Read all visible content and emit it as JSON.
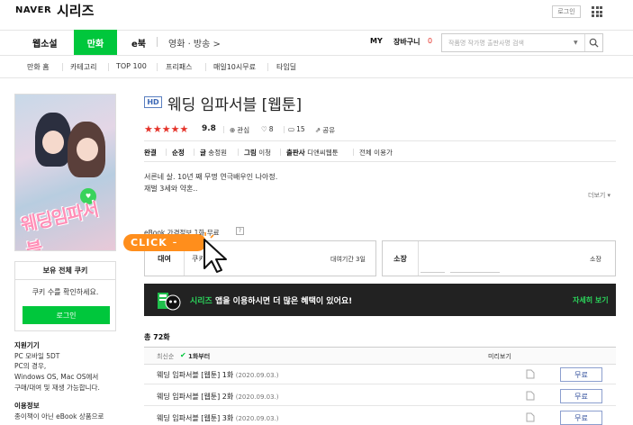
{
  "header": {
    "brand_naver": "NAVER",
    "brand_series": "시리즈",
    "login": "로그인"
  },
  "nav": {
    "items": [
      "웹소설",
      "만화",
      "e북"
    ],
    "active": "만화",
    "movie": "영화 · 방송 >",
    "my": "MY",
    "cart": "장바구니",
    "cart_count": "0",
    "search_placeholder": "작품명  작가명  출판사명 검색",
    "search_caret": "▼"
  },
  "subnav": [
    "만화 홈",
    "카테고리",
    "TOP 100",
    "프리패스",
    "매일10시무료",
    "타임딜"
  ],
  "product": {
    "badge": "HD",
    "title": "웨딩 임파서블 [웹툰]",
    "stars": "★★★★★",
    "rating": "9.8",
    "meta": {
      "watch": "관심",
      "like_count": "8",
      "comment_count": "15",
      "share": "공유"
    },
    "info": {
      "status": "완결",
      "genre": "순정",
      "writer_label": "글",
      "writer": "송정원",
      "art_label": "그림",
      "artist": "이청",
      "publisher_label": "출판사",
      "publisher": "디앤씨웹툰",
      "age": "전체 이용가"
    },
    "desc_line1": "서른네 살. 10년 째 무명 연극배우인 나아정.",
    "desc_line2": "재벌 3세와 약혼..",
    "more": "더보기 ▾",
    "ebook_head": "eBook 가격정보 1화 무료",
    "ebook_help": "?",
    "rent_label": "대여",
    "rent_cookie": "쿠키",
    "rent_period": "대여기간 3일",
    "own_label": "소장",
    "own_text": "소장"
  },
  "click_badge": "CLICK",
  "cover": {
    "title_art": "웨딩임파서블"
  },
  "cookie_box": {
    "head": "보유 전체 쿠키",
    "message": "쿠키 수를 확인하세요.",
    "login": "로그인"
  },
  "left_info": {
    "device_head": "지원기기",
    "device_lines": [
      "PC 모바일 5DT",
      "PC의 경우,",
      "Windows OS, Mac OS에서",
      "구매/대여 및 재생 가능합니다."
    ],
    "usage_head": "이용정보",
    "usage_lines": [
      "종이책이 아닌 eBook 상품으로"
    ]
  },
  "banner": {
    "text_green": "시리즈",
    "text_white": " 앱을 이용하시면 더 많은 혜택이 있어요!",
    "more": "자세히 보기"
  },
  "episodes": {
    "count": "총 72화",
    "sort_latest": "최신순",
    "sort_first": "1화부터",
    "preview_header": "미리보기",
    "rows": [
      {
        "title": "웨딩 임파서블 [웹툰] 1화",
        "date": "(2020.09.03.)",
        "button": "무료"
      },
      {
        "title": "웨딩 임파서블 [웹툰] 2화",
        "date": "(2020.09.03.)",
        "button": "무료"
      },
      {
        "title": "웨딩 임파서블 [웹툰] 3화",
        "date": "(2020.09.03.)",
        "button": "무료"
      }
    ]
  },
  "colors": {
    "brand_green": "#00c73c",
    "star_red": "#e5332a",
    "click_orange": "#ff8e1c",
    "button_blue": "#2d4b9a"
  }
}
